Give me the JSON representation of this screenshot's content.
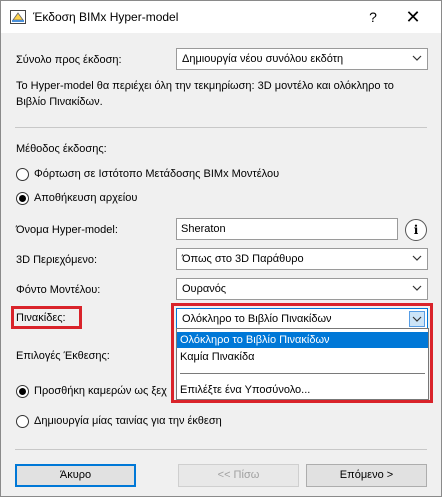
{
  "window": {
    "title": "Έκδοση BIMx Hyper-model"
  },
  "titlebar": {
    "help": "?",
    "close": "✕"
  },
  "export_set": {
    "label": "Σύνολο προς έκδοση:",
    "value": "Δημιουργία νέου συνόλου εκδότη",
    "note_line1": "Το Hyper-model θα περιέχει όλη την τεκμηρίωση: 3D μοντέλο και ολόκληρο το",
    "note_line2": "Βιβλίο Πινακίδων."
  },
  "method": {
    "label": "Μέθοδος έκδοσης:",
    "option_upload": "Φόρτωση σε Ιστότοπο Μετάδοσης BIMx Μοντέλου",
    "option_save": "Αποθήκευση αρχείου",
    "selected": "Αποθήκευση αρχείου"
  },
  "hypermodel_name": {
    "label": "Όνομα Hyper-model:",
    "value": "Sheraton",
    "info": "i"
  },
  "content_3d": {
    "label": "3D Περιεχόμενο:",
    "value": "Όπως στο 3D Παράθυρο"
  },
  "background": {
    "label": "Φόντο Μοντέλου:",
    "value": "Ουρανός"
  },
  "layouts": {
    "label": "Πινακίδες:",
    "value": "Ολόκληρο το Βιβλίο Πινακίδων",
    "options": [
      "Ολόκληρο το Βιβλίο Πινακίδων",
      "Καμία Πινακίδα",
      "Επιλέξτε ένα Υποσύνολο..."
    ],
    "selected_index": 0
  },
  "display_options": {
    "label": "Επιλογές Έκθεσης:",
    "option_cameras": "Προσθήκη καμερών ως ξεχ",
    "option_movie": "Δημιουργία μίας ταινίας για την έκθεση"
  },
  "footer": {
    "cancel": "Άκυρο",
    "back": "<< Πίσω",
    "next": "Επόμενο >"
  },
  "colors": {
    "highlight": "#0078d7",
    "annotation_red": "#d9232a"
  }
}
